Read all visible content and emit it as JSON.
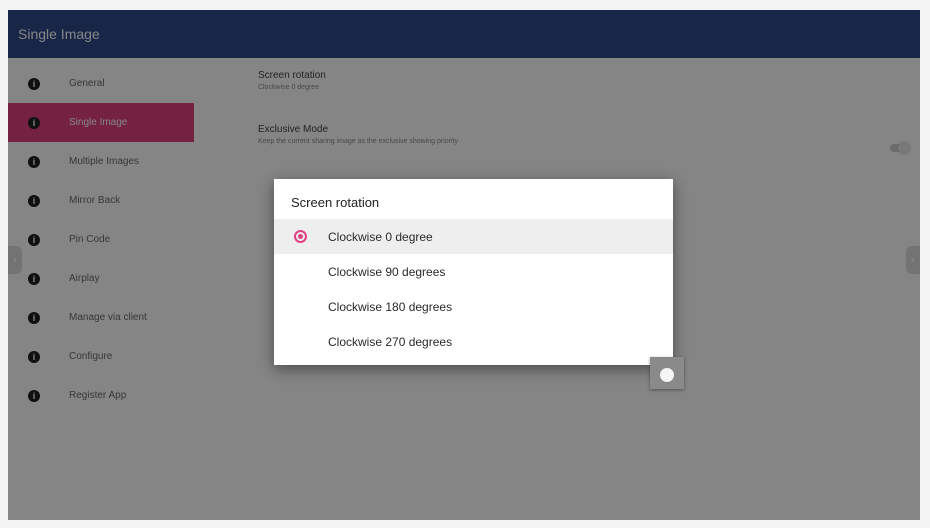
{
  "app": {
    "title": "Single Image"
  },
  "sidebar": {
    "items": [
      {
        "label": "General",
        "icon": "info-icon"
      },
      {
        "label": "Single Image",
        "icon": "info-icon",
        "active": true
      },
      {
        "label": "Multiple Images",
        "icon": "info-icon"
      },
      {
        "label": "Mirror Back",
        "icon": "info-icon"
      },
      {
        "label": "Pin Code",
        "icon": "info-icon"
      },
      {
        "label": "Airplay",
        "icon": "info-icon"
      },
      {
        "label": "Manage via client",
        "icon": "info-icon"
      },
      {
        "label": "Configure",
        "icon": "info-icon"
      },
      {
        "label": "Register App",
        "icon": "info-icon"
      }
    ]
  },
  "settings": {
    "screen_rotation": {
      "title": "Screen rotation",
      "value": "Clockwise 0 degree"
    },
    "exclusive_mode": {
      "title": "Exclusive Mode",
      "description": "Keep the current sharing image as the exclusive showing priority",
      "enabled": false
    }
  },
  "dialog": {
    "title": "Screen rotation",
    "options": [
      {
        "label": "Clockwise 0 degree",
        "selected": true
      },
      {
        "label": "Clockwise 90 degrees",
        "selected": false
      },
      {
        "label": "Clockwise 180 degrees",
        "selected": false
      },
      {
        "label": "Clockwise 270 degrees",
        "selected": false
      }
    ]
  },
  "handles": {
    "left": "›",
    "right": "‹"
  },
  "colors": {
    "topbar": "#2f4a8a",
    "accent": "#e0407e"
  }
}
